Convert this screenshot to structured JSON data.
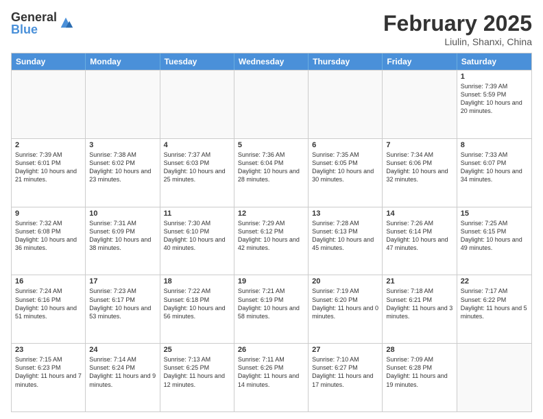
{
  "header": {
    "logo_general": "General",
    "logo_blue": "Blue",
    "month_year": "February 2025",
    "location": "Liulin, Shanxi, China"
  },
  "weekdays": [
    "Sunday",
    "Monday",
    "Tuesday",
    "Wednesday",
    "Thursday",
    "Friday",
    "Saturday"
  ],
  "weeks": [
    [
      {
        "day": "",
        "empty": true
      },
      {
        "day": "",
        "empty": true
      },
      {
        "day": "",
        "empty": true
      },
      {
        "day": "",
        "empty": true
      },
      {
        "day": "",
        "empty": true
      },
      {
        "day": "",
        "empty": true
      },
      {
        "day": "1",
        "sunrise": "Sunrise: 7:39 AM",
        "sunset": "Sunset: 5:59 PM",
        "daylight": "Daylight: 10 hours and 20 minutes."
      }
    ],
    [
      {
        "day": "2",
        "sunrise": "Sunrise: 7:39 AM",
        "sunset": "Sunset: 6:01 PM",
        "daylight": "Daylight: 10 hours and 21 minutes."
      },
      {
        "day": "3",
        "sunrise": "Sunrise: 7:38 AM",
        "sunset": "Sunset: 6:02 PM",
        "daylight": "Daylight: 10 hours and 23 minutes."
      },
      {
        "day": "4",
        "sunrise": "Sunrise: 7:37 AM",
        "sunset": "Sunset: 6:03 PM",
        "daylight": "Daylight: 10 hours and 25 minutes."
      },
      {
        "day": "5",
        "sunrise": "Sunrise: 7:36 AM",
        "sunset": "Sunset: 6:04 PM",
        "daylight": "Daylight: 10 hours and 28 minutes."
      },
      {
        "day": "6",
        "sunrise": "Sunrise: 7:35 AM",
        "sunset": "Sunset: 6:05 PM",
        "daylight": "Daylight: 10 hours and 30 minutes."
      },
      {
        "day": "7",
        "sunrise": "Sunrise: 7:34 AM",
        "sunset": "Sunset: 6:06 PM",
        "daylight": "Daylight: 10 hours and 32 minutes."
      },
      {
        "day": "8",
        "sunrise": "Sunrise: 7:33 AM",
        "sunset": "Sunset: 6:07 PM",
        "daylight": "Daylight: 10 hours and 34 minutes."
      }
    ],
    [
      {
        "day": "9",
        "sunrise": "Sunrise: 7:32 AM",
        "sunset": "Sunset: 6:08 PM",
        "daylight": "Daylight: 10 hours and 36 minutes."
      },
      {
        "day": "10",
        "sunrise": "Sunrise: 7:31 AM",
        "sunset": "Sunset: 6:09 PM",
        "daylight": "Daylight: 10 hours and 38 minutes."
      },
      {
        "day": "11",
        "sunrise": "Sunrise: 7:30 AM",
        "sunset": "Sunset: 6:10 PM",
        "daylight": "Daylight: 10 hours and 40 minutes."
      },
      {
        "day": "12",
        "sunrise": "Sunrise: 7:29 AM",
        "sunset": "Sunset: 6:12 PM",
        "daylight": "Daylight: 10 hours and 42 minutes."
      },
      {
        "day": "13",
        "sunrise": "Sunrise: 7:28 AM",
        "sunset": "Sunset: 6:13 PM",
        "daylight": "Daylight: 10 hours and 45 minutes."
      },
      {
        "day": "14",
        "sunrise": "Sunrise: 7:26 AM",
        "sunset": "Sunset: 6:14 PM",
        "daylight": "Daylight: 10 hours and 47 minutes."
      },
      {
        "day": "15",
        "sunrise": "Sunrise: 7:25 AM",
        "sunset": "Sunset: 6:15 PM",
        "daylight": "Daylight: 10 hours and 49 minutes."
      }
    ],
    [
      {
        "day": "16",
        "sunrise": "Sunrise: 7:24 AM",
        "sunset": "Sunset: 6:16 PM",
        "daylight": "Daylight: 10 hours and 51 minutes."
      },
      {
        "day": "17",
        "sunrise": "Sunrise: 7:23 AM",
        "sunset": "Sunset: 6:17 PM",
        "daylight": "Daylight: 10 hours and 53 minutes."
      },
      {
        "day": "18",
        "sunrise": "Sunrise: 7:22 AM",
        "sunset": "Sunset: 6:18 PM",
        "daylight": "Daylight: 10 hours and 56 minutes."
      },
      {
        "day": "19",
        "sunrise": "Sunrise: 7:21 AM",
        "sunset": "Sunset: 6:19 PM",
        "daylight": "Daylight: 10 hours and 58 minutes."
      },
      {
        "day": "20",
        "sunrise": "Sunrise: 7:19 AM",
        "sunset": "Sunset: 6:20 PM",
        "daylight": "Daylight: 11 hours and 0 minutes."
      },
      {
        "day": "21",
        "sunrise": "Sunrise: 7:18 AM",
        "sunset": "Sunset: 6:21 PM",
        "daylight": "Daylight: 11 hours and 3 minutes."
      },
      {
        "day": "22",
        "sunrise": "Sunrise: 7:17 AM",
        "sunset": "Sunset: 6:22 PM",
        "daylight": "Daylight: 11 hours and 5 minutes."
      }
    ],
    [
      {
        "day": "23",
        "sunrise": "Sunrise: 7:15 AM",
        "sunset": "Sunset: 6:23 PM",
        "daylight": "Daylight: 11 hours and 7 minutes."
      },
      {
        "day": "24",
        "sunrise": "Sunrise: 7:14 AM",
        "sunset": "Sunset: 6:24 PM",
        "daylight": "Daylight: 11 hours and 9 minutes."
      },
      {
        "day": "25",
        "sunrise": "Sunrise: 7:13 AM",
        "sunset": "Sunset: 6:25 PM",
        "daylight": "Daylight: 11 hours and 12 minutes."
      },
      {
        "day": "26",
        "sunrise": "Sunrise: 7:11 AM",
        "sunset": "Sunset: 6:26 PM",
        "daylight": "Daylight: 11 hours and 14 minutes."
      },
      {
        "day": "27",
        "sunrise": "Sunrise: 7:10 AM",
        "sunset": "Sunset: 6:27 PM",
        "daylight": "Daylight: 11 hours and 17 minutes."
      },
      {
        "day": "28",
        "sunrise": "Sunrise: 7:09 AM",
        "sunset": "Sunset: 6:28 PM",
        "daylight": "Daylight: 11 hours and 19 minutes."
      },
      {
        "day": "",
        "empty": true
      }
    ]
  ]
}
